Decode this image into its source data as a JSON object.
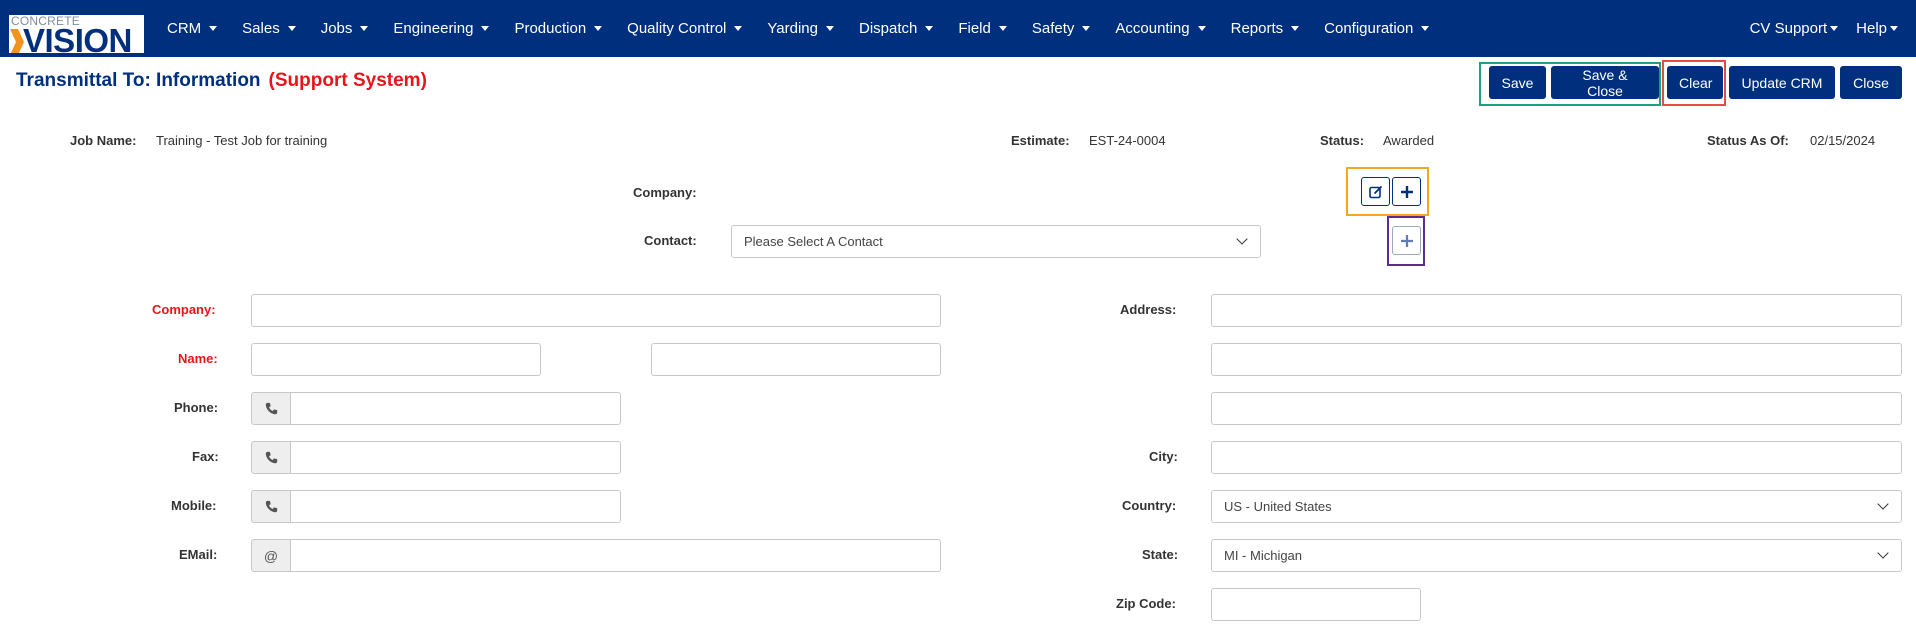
{
  "app": {
    "logo_top": "CONCRETE",
    "logo_bottom": "VISION"
  },
  "nav": {
    "items": [
      {
        "label": "CRM"
      },
      {
        "label": "Sales"
      },
      {
        "label": "Jobs"
      },
      {
        "label": "Engineering"
      },
      {
        "label": "Production"
      },
      {
        "label": "Quality Control"
      },
      {
        "label": "Yarding"
      },
      {
        "label": "Dispatch"
      },
      {
        "label": "Field"
      },
      {
        "label": "Safety"
      },
      {
        "label": "Accounting"
      },
      {
        "label": "Reports"
      },
      {
        "label": "Configuration"
      }
    ],
    "right": [
      {
        "label": "CV Support"
      },
      {
        "label": "Help"
      }
    ]
  },
  "header": {
    "title": "Transmittal To: Information",
    "system": "(Support System)"
  },
  "toolbar": {
    "save": "Save",
    "save_close": "Save & Close",
    "clear": "Clear",
    "update_crm": "Update CRM",
    "close": "Close"
  },
  "info": {
    "job_name_label": "Job Name:",
    "job_name": "Training - Test Job for training",
    "estimate_label": "Estimate:",
    "estimate": "EST-24-0004",
    "status_label": "Status:",
    "status": "Awarded",
    "status_as_of_label": "Status As Of:",
    "status_as_of": "02/15/2024"
  },
  "lookup": {
    "company_label": "Company:",
    "contact_label": "Contact:",
    "contact_placeholder": "Please Select A Contact"
  },
  "form": {
    "company_label": "Company:",
    "name_label": "Name:",
    "phone_label": "Phone:",
    "fax_label": "Fax:",
    "mobile_label": "Mobile:",
    "email_label": "EMail:",
    "email_addon": "@",
    "address_label": "Address:",
    "city_label": "City:",
    "country_label": "Country:",
    "country_value": "US - United States",
    "state_label": "State:",
    "state_value": "MI - Michigan",
    "zip_label": "Zip Code:"
  },
  "colors": {
    "brand": "#00307d",
    "required": "#e8141c",
    "highlight_save": "#1aa37f",
    "highlight_clear": "#e84a4a",
    "highlight_company_buttons": "#f3a81e",
    "highlight_contact_add": "#5b2d8e"
  }
}
